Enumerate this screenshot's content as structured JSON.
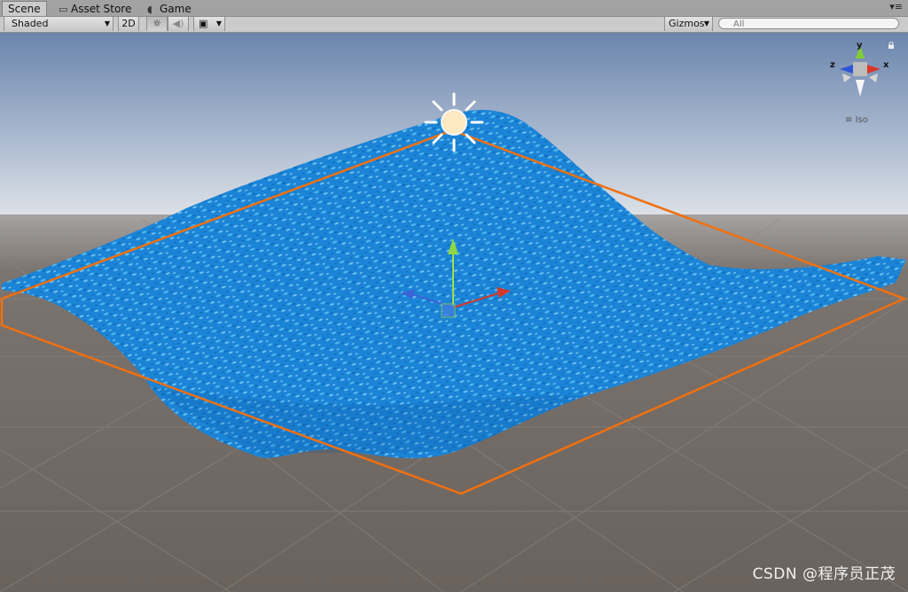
{
  "tabs": [
    {
      "label": "Scene",
      "icon": "scene-icon",
      "active": true
    },
    {
      "label": "Asset Store",
      "icon": "store-icon",
      "active": false
    },
    {
      "label": "Game",
      "icon": "pacman-icon",
      "active": false
    }
  ],
  "toolbar": {
    "draw_mode": "Shaded",
    "mode_2d": "2D",
    "lighting_icon": "sun-icon",
    "audio_icon": "speaker-icon",
    "effects_icon": "image-icon",
    "gizmos": "Gizmos",
    "search_placeholder": "All"
  },
  "gizmo": {
    "axis_y": "y",
    "axis_x": "x",
    "axis_z": "z",
    "projection": "Iso",
    "colors": {
      "x": "#d9372b",
      "y": "#7fcf32",
      "z": "#2f54d8",
      "center": "#bdbdbd"
    }
  },
  "scene": {
    "sky_top": "#6f88b0",
    "horizon": "#d8dde5",
    "ground": "#6c6560",
    "water": "#1a82d4",
    "selection_outline": "#f07010",
    "light_icon": "directional-light-icon"
  },
  "watermark": "CSDN @程序员正茂"
}
